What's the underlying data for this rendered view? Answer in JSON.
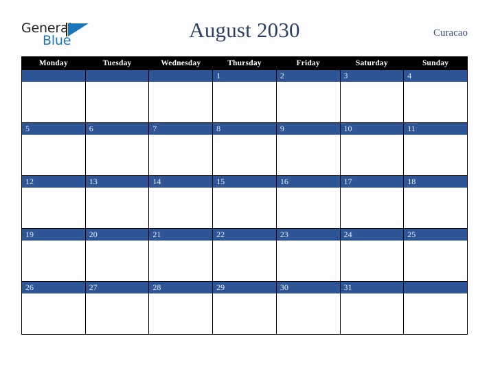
{
  "brand": {
    "name_part1": "General",
    "name_part2": "Blue",
    "triangle_icon": "blue-triangle-icon",
    "colors": {
      "dark": "#231f20",
      "blue": "#1b75bb"
    }
  },
  "header": {
    "title": "August 2030",
    "month": "August",
    "year": "2030",
    "country": "Curacao"
  },
  "calendar": {
    "accent_color": "#2e5596",
    "header_bg": "#000000",
    "day_headers": [
      "Monday",
      "Tuesday",
      "Wednesday",
      "Thursday",
      "Friday",
      "Saturday",
      "Sunday"
    ],
    "weeks": [
      [
        {
          "day": "",
          "blank": true
        },
        {
          "day": "",
          "blank": true
        },
        {
          "day": "",
          "blank": true
        },
        {
          "day": "1",
          "blank": false
        },
        {
          "day": "2",
          "blank": false
        },
        {
          "day": "3",
          "blank": false
        },
        {
          "day": "4",
          "blank": false
        }
      ],
      [
        {
          "day": "5",
          "blank": false
        },
        {
          "day": "6",
          "blank": false
        },
        {
          "day": "7",
          "blank": false
        },
        {
          "day": "8",
          "blank": false
        },
        {
          "day": "9",
          "blank": false
        },
        {
          "day": "10",
          "blank": false
        },
        {
          "day": "11",
          "blank": false
        }
      ],
      [
        {
          "day": "12",
          "blank": false
        },
        {
          "day": "13",
          "blank": false
        },
        {
          "day": "14",
          "blank": false
        },
        {
          "day": "15",
          "blank": false
        },
        {
          "day": "16",
          "blank": false
        },
        {
          "day": "17",
          "blank": false
        },
        {
          "day": "18",
          "blank": false
        }
      ],
      [
        {
          "day": "19",
          "blank": false
        },
        {
          "day": "20",
          "blank": false
        },
        {
          "day": "21",
          "blank": false
        },
        {
          "day": "22",
          "blank": false
        },
        {
          "day": "23",
          "blank": false
        },
        {
          "day": "24",
          "blank": false
        },
        {
          "day": "25",
          "blank": false
        }
      ],
      [
        {
          "day": "26",
          "blank": false
        },
        {
          "day": "27",
          "blank": false
        },
        {
          "day": "28",
          "blank": false
        },
        {
          "day": "29",
          "blank": false
        },
        {
          "day": "30",
          "blank": false
        },
        {
          "day": "31",
          "blank": false
        },
        {
          "day": "",
          "blank": true
        }
      ]
    ]
  }
}
